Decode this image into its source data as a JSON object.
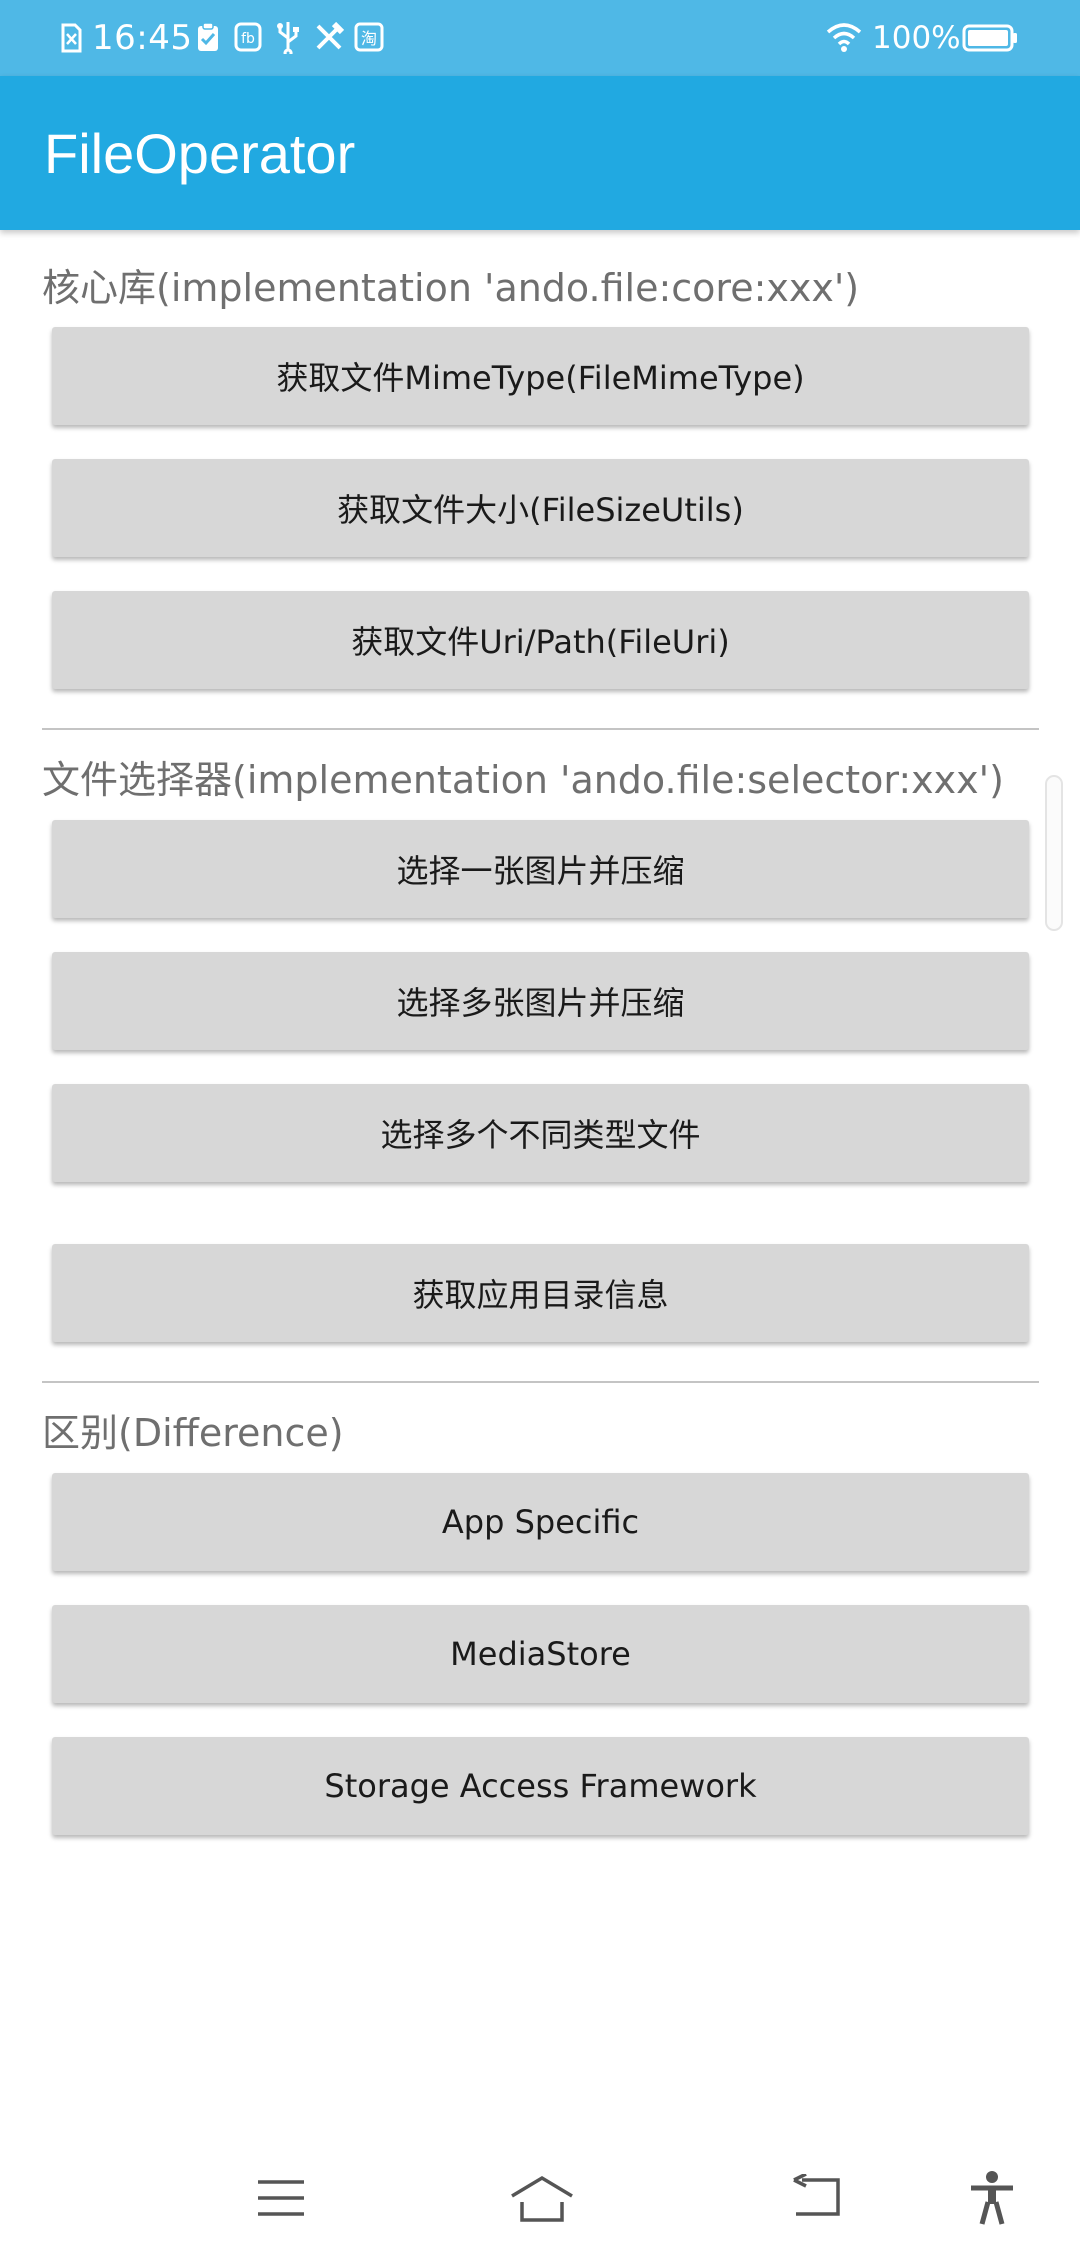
{
  "status_bar": {
    "time": "16:45",
    "battery_percent": "100%",
    "icons": [
      "sim-off-icon",
      "checklist-icon",
      "app-notification-icon",
      "usb-icon",
      "tools-icon",
      "taobao-icon",
      "wifi-icon",
      "battery-icon"
    ]
  },
  "app_bar": {
    "title": "FileOperator"
  },
  "sections": [
    {
      "title": "核心库(implementation 'ando.file:core:xxx')",
      "buttons": [
        "获取文件MimeType(FileMimeType)",
        "获取文件大小(FileSizeUtils)",
        "获取文件Uri/Path(FileUri)"
      ]
    },
    {
      "title": "文件选择器(implementation 'ando.file:selector:xxx')",
      "buttons": [
        "选择一张图片并压缩",
        "选择多张图片并压缩",
        "选择多个不同类型文件",
        "获取应用目录信息"
      ]
    },
    {
      "title": "区别(Difference)",
      "buttons": [
        "App Specific",
        "MediaStore",
        "Storage Access Framework"
      ]
    }
  ],
  "nav_bar": {
    "icons": [
      "menu-icon",
      "home-icon",
      "back-icon",
      "accessibility-icon"
    ]
  },
  "colors": {
    "status_bar": "#4fb8e6",
    "app_bar": "#21a9e1",
    "button": "#d7d7d7",
    "section_title": "#6f6f6f"
  }
}
